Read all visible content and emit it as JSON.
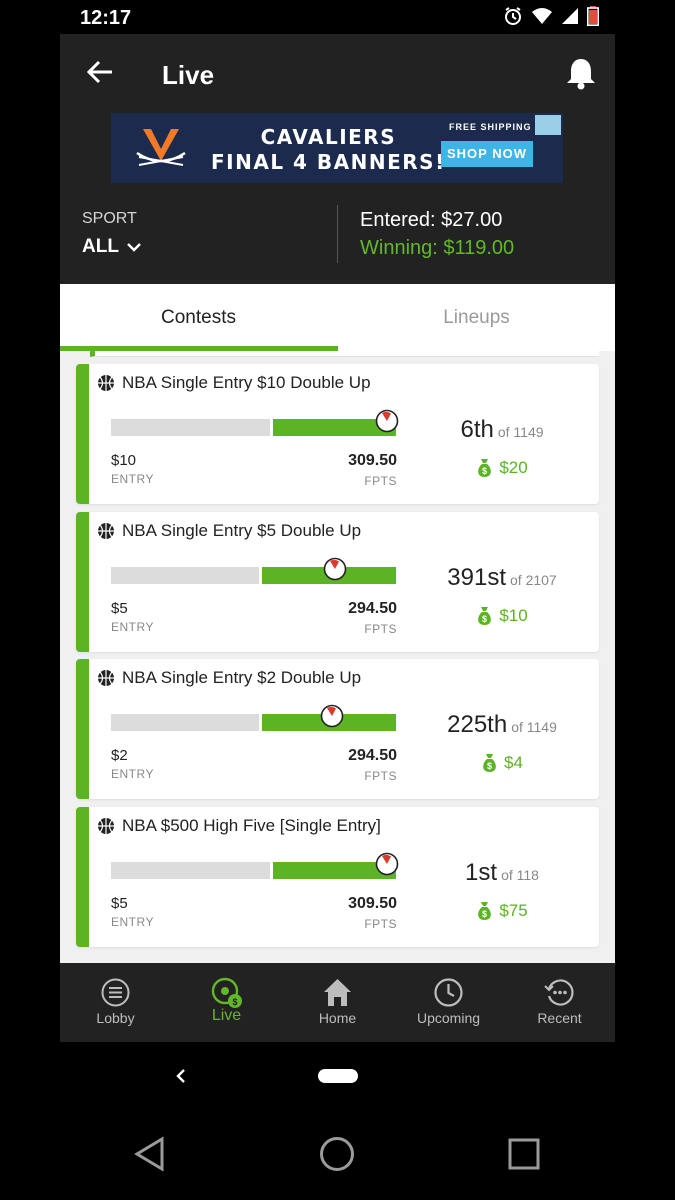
{
  "status_bar": {
    "time": "12:17"
  },
  "header": {
    "title": "Live",
    "sport_label": "SPORT",
    "sport_value": "ALL",
    "entered": "Entered: $27.00",
    "winning": "Winning: $119.00"
  },
  "ad": {
    "line1": "CAVALIERS",
    "line2": "FINAL 4 BANNERS!",
    "shipping": "FREE SHIPPING",
    "shop": "SHOP NOW"
  },
  "tabs": [
    {
      "label": "Contests",
      "active": true
    },
    {
      "label": "Lineups",
      "active": false
    }
  ],
  "contests": [
    {
      "title": "NBA Single Entry $10 Double Up",
      "entry": "$10",
      "entry_label": "ENTRY",
      "fpts": "309.50",
      "fpts_label": "FPTS",
      "rank": "6th",
      "of": "of 1149",
      "prize": "$20",
      "progress": 1.0
    },
    {
      "title": "NBA Single Entry $5 Double Up",
      "entry": "$5",
      "entry_label": "ENTRY",
      "fpts": "294.50",
      "fpts_label": "FPTS",
      "rank": "391st",
      "of": "of 2107",
      "prize": "$10",
      "progress": 0.81
    },
    {
      "title": "NBA Single Entry $2 Double Up",
      "entry": "$2",
      "entry_label": "ENTRY",
      "fpts": "294.50",
      "fpts_label": "FPTS",
      "rank": "225th",
      "of": "of 1149",
      "prize": "$4",
      "progress": 0.8
    },
    {
      "title": "NBA $500 High Five [Single Entry]",
      "entry": "$5",
      "entry_label": "ENTRY",
      "fpts": "309.50",
      "fpts_label": "FPTS",
      "rank": "1st",
      "of": "of 118",
      "prize": "$75",
      "progress": 1.0
    }
  ],
  "bottom_nav": [
    {
      "label": "Lobby",
      "icon": "list-circle-icon",
      "active": false
    },
    {
      "label": "Live",
      "icon": "live-money-icon",
      "active": true
    },
    {
      "label": "Home",
      "icon": "home-icon",
      "active": false
    },
    {
      "label": "Upcoming",
      "icon": "clock-icon",
      "active": false
    },
    {
      "label": "Recent",
      "icon": "history-icon",
      "active": false
    }
  ],
  "colors": {
    "accent_green": "#5ab424",
    "header_bg": "#222222",
    "winning_green": "#62b82b"
  }
}
